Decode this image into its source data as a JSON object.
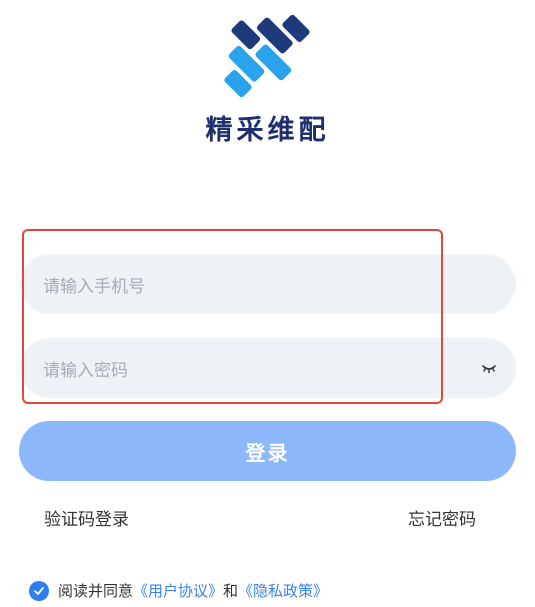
{
  "brand": {
    "name": "精采维配",
    "colors": {
      "dark": "#1e3a7b",
      "light": "#2aa3ec"
    }
  },
  "form": {
    "phone_placeholder": "请输入手机号",
    "password_placeholder": "请输入密码",
    "password_toggle_icon": "eye-closed-icon"
  },
  "actions": {
    "login_label": "登录",
    "sms_login_label": "验证码登录",
    "forgot_password_label": "忘记密码"
  },
  "agreement": {
    "checked": true,
    "prefix": "阅读并同意",
    "user_agreement": "《用户协议》",
    "conjunction": "和",
    "privacy_policy": "《隐私政策》"
  },
  "colors": {
    "login_button": "#8cb8fb",
    "input_bg": "#eef1f6",
    "highlight_border": "#e0493a",
    "link_blue": "#3a80e8"
  }
}
